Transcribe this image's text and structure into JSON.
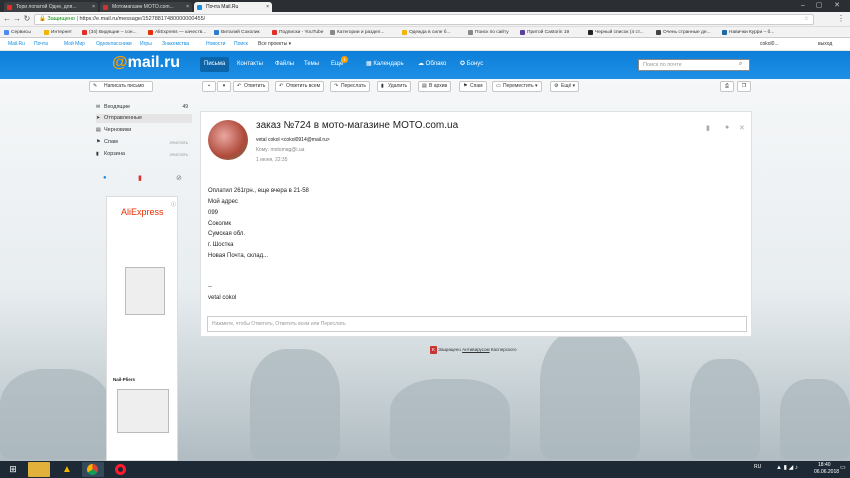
{
  "browser": {
    "tabs": [
      {
        "title": "Тори лопатой Одне, для..."
      },
      {
        "title": "Мотомагазин MOTO.com..."
      },
      {
        "title": "Почта Mail.Ru"
      }
    ],
    "secure_label": "Защищено",
    "url": "https://e.mail.ru/message/15278817480000000455/",
    "bookmarks": [
      "Сервисы",
      "Интернет",
      "(34) Видящие – сон...",
      "AliExpress — качеств...",
      "Виталий Соколик",
      "Подписки - YouTube",
      "Категории и раздел...",
      "Одежда в силе б...",
      "Поиск по сайту",
      "Притой Castorin 19",
      "Черный список (4 ст...",
      "Очень странные де...",
      "Навички Курри – б..."
    ]
  },
  "portal": {
    "links": [
      "Mail.Ru",
      "Почта",
      "Мой Мир",
      "Одноклассники",
      "Игры",
      "Знакомства",
      "Новости",
      "Поиск",
      "Все проекты ▾"
    ],
    "user": "cokol0...",
    "logout": "выход"
  },
  "header": {
    "logo_at": "@",
    "logo_text": "mail.ru",
    "nav": [
      "Письма",
      "Контакты",
      "Файлы",
      "Темы",
      "Ещё",
      "Календарь",
      "Облако",
      "Бонус"
    ],
    "badge": "1",
    "search_placeholder": "Поиск по почте"
  },
  "toolbar": {
    "compose": "Написать письмо",
    "buttons": [
      "Ответить",
      "Ответить всем",
      "Переслать",
      "Удалить",
      "В архив",
      "Спам",
      "Переместить ▾",
      "Ещё ▾"
    ]
  },
  "sidebar": {
    "folders": [
      {
        "label": "Входящие",
        "count": "49"
      },
      {
        "label": "Отправленные",
        "count": ""
      },
      {
        "label": "Черновики",
        "count": ""
      },
      {
        "label": "Спам",
        "count": "очистить"
      },
      {
        "label": "Корзина",
        "count": "очистить"
      }
    ]
  },
  "ad": {
    "brand": "AliExpress",
    "product": "Nail-Pliers"
  },
  "message": {
    "subject": "заказ №724 в мото-магазине MOTO.com.ua",
    "from": "vetal cokol <cokol0914@mail.ru>",
    "to": "Кому: motomag@i.ua",
    "date": "1 июня, 22:35",
    "body": [
      "Оплатил 261грн., еще вчера в 21-58",
      "Мой адрес",
      "099",
      "Соколик",
      "Сумская обл.",
      "г. Шостка",
      "Новая Почта, склад...",
      "",
      "--",
      "vetal cokol"
    ],
    "reply_placeholder": "Нажмите, чтобы Ответить, Ответить всем или Переслать"
  },
  "protection": {
    "text": "Защищено",
    "link": "Антивирусом",
    "suffix": "Касперского"
  },
  "taskbar": {
    "lang": "RU",
    "time": "18:40",
    "date": "06.06.2018"
  }
}
